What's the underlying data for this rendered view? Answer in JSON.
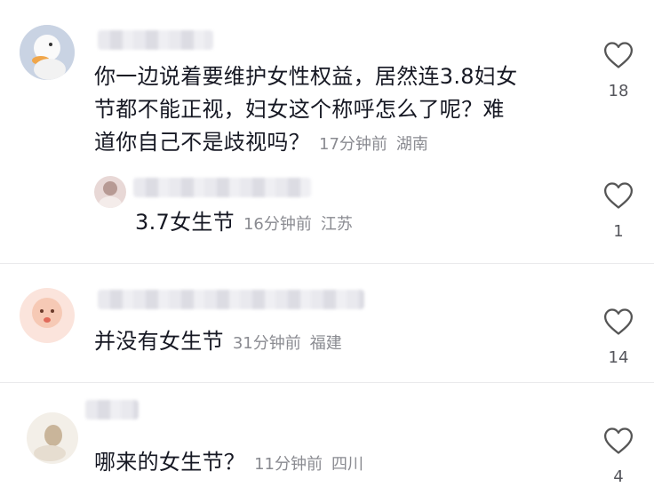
{
  "comments": [
    {
      "text": "你一边说着要维护女性权益，居然连3.8妇女节都不能正视，妇女这个称呼怎么了呢？难道你自己不是歧视吗？",
      "line1": "你一边说着要维护女性权益，居然连3.8妇女",
      "line2": "节都不能正视，妇女这个称呼怎么了呢？难",
      "line3": "道你自己不是歧视吗？",
      "time": "17分钟前",
      "location": "湖南",
      "likes": "18"
    },
    {
      "text": "3.7女生节",
      "time": "16分钟前",
      "location": "江苏",
      "likes": "1"
    },
    {
      "text": "并没有女生节",
      "time": "31分钟前",
      "location": "福建",
      "likes": "14"
    },
    {
      "text": "哪来的女生节？",
      "time": "11分钟前",
      "location": "四川",
      "likes": "4"
    }
  ],
  "icons": {
    "like": "heart-outline-icon"
  },
  "colors": {
    "text": "#161823",
    "meta": "#8a8b91",
    "icon": "#555555"
  }
}
